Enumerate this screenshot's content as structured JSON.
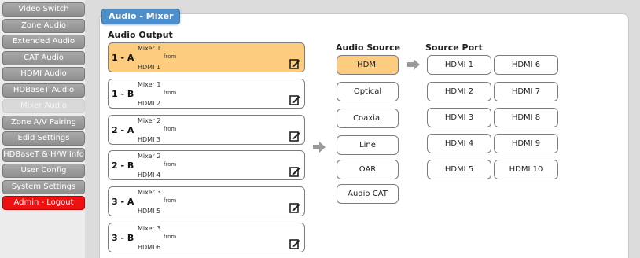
{
  "sidebar": {
    "items": [
      {
        "label": "Video Switch"
      },
      {
        "label": "Zone Audio"
      },
      {
        "label": "Extended Audio"
      },
      {
        "label": "CAT Audio"
      },
      {
        "label": "HDMI Audio"
      },
      {
        "label": "HDBaseT Audio"
      },
      {
        "label": "Mixer Audio",
        "active": true
      },
      {
        "label": "Zone A/V Pairing"
      },
      {
        "label": "Edid Settings"
      },
      {
        "label": "HDBaseT & H/W Info"
      },
      {
        "label": "User Config"
      },
      {
        "label": "System Settings"
      },
      {
        "label": "Admin - Logout",
        "logout": true
      }
    ]
  },
  "panel": {
    "title": "Audio - Mixer"
  },
  "audio_output": {
    "heading": "Audio Output",
    "from_label": "from",
    "items": [
      {
        "name": "1 - A",
        "mixer": "Mixer 1",
        "port": "HDMI 1",
        "selected": true
      },
      {
        "name": "1 - B",
        "mixer": "Mixer 1",
        "port": "HDMI 2"
      },
      {
        "name": "2 - A",
        "mixer": "Mixer 2",
        "port": "HDMI 3"
      },
      {
        "name": "2 - B",
        "mixer": "Mixer 2",
        "port": "HDMI 4"
      },
      {
        "name": "3 - A",
        "mixer": "Mixer 3",
        "port": "HDMI 5"
      },
      {
        "name": "3 - B",
        "mixer": "Mixer 3",
        "port": "HDMI 6"
      }
    ]
  },
  "audio_source": {
    "heading": "Audio Source",
    "items": [
      {
        "label": "HDMI",
        "selected": true
      },
      {
        "label": "Optical"
      },
      {
        "label": "Coaxial"
      },
      {
        "label": "Line"
      },
      {
        "label": "OAR"
      },
      {
        "label": "Audio CAT"
      }
    ]
  },
  "source_port": {
    "heading": "Source Port",
    "col1": [
      "HDMI 1",
      "HDMI 2",
      "HDMI 3",
      "HDMI 4",
      "HDMI 5"
    ],
    "col2": [
      "HDMI 6",
      "HDMI 7",
      "HDMI 8",
      "HDMI 9",
      "HDMI 10"
    ]
  },
  "colors": {
    "selected": "#fdcc7e",
    "tab": "#4d8fcc",
    "logout": "#ee1111"
  }
}
